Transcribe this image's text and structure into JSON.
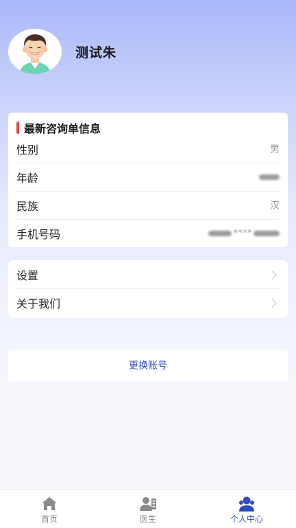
{
  "profile": {
    "name": "测试朱"
  },
  "info_card": {
    "title": "最新咨询单信息",
    "rows": [
      {
        "label": "性别",
        "value": "男"
      },
      {
        "label": "年龄",
        "value": ""
      },
      {
        "label": "民族",
        "value": "汉"
      },
      {
        "label": "手机号码",
        "value": "****"
      }
    ]
  },
  "menu": {
    "items": [
      {
        "label": "设置"
      },
      {
        "label": "关于我们"
      }
    ]
  },
  "switch_account": {
    "label": "更换账号"
  },
  "tabbar": {
    "tabs": [
      {
        "label": "首页",
        "icon": "home-icon"
      },
      {
        "label": "医生",
        "icon": "doctor-icon"
      },
      {
        "label": "个人中心",
        "icon": "user-icon"
      }
    ],
    "active": "个人中心"
  },
  "colors": {
    "accent": "#2b4bc1",
    "title_bar": "#e0474e"
  }
}
